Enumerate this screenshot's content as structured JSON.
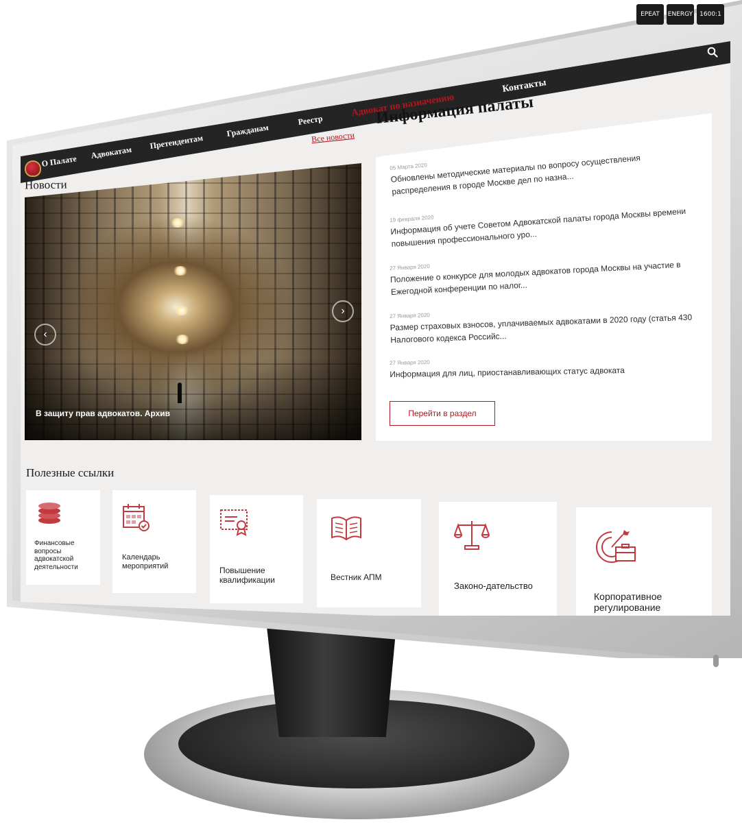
{
  "monitor": {
    "badges": [
      "EPEAT",
      "ENERGY",
      "1600:1"
    ]
  },
  "nav": {
    "items": [
      "О Палате",
      "Адвокатам",
      "Претендентам",
      "Гражданам",
      "Реестр",
      "Адвокат по назначению",
      "Контакты"
    ],
    "search_icon": "search-icon",
    "accent_color": "#b5151e",
    "bar_color": "#242424"
  },
  "news": {
    "title": "Новости",
    "all_news": "Все новости",
    "photo_caption": "В защиту прав адвокатов. Архив"
  },
  "info": {
    "title": "Информация палаты",
    "items": [
      {
        "date": "05 Марта 2020",
        "text": "Обновлены методические материалы по вопросу осуществления распределения в городе Москве дел по назна..."
      },
      {
        "date": "19 февраля 2020",
        "text": "Информация об учете Советом Адвокатской палаты города Москвы времени повышения профессионального уро..."
      },
      {
        "date": "27 Января 2020",
        "text": "Положение о конкурсе для молодых адвокатов города Москвы на участие в Ежегодной конференции по налог..."
      },
      {
        "date": "27 Января 2020",
        "text": "Размер страховых взносов, уплачиваемых адвокатами в 2020 году (статья 430 Налогового кодекса Российс..."
      },
      {
        "date": "27 Января 2020",
        "text": "Информация для лиц, приостанавливающих статус адвоката"
      }
    ],
    "button": "Перейти в раздел"
  },
  "links": {
    "title": "Полезные ссылки",
    "items": [
      {
        "label": "Финансовые вопросы адвокатской деятельности",
        "icon": "coins-icon"
      },
      {
        "label": "Календарь мероприятий",
        "icon": "calendar-icon"
      },
      {
        "label": "Повышение квалификации",
        "icon": "certificate-icon"
      },
      {
        "label": "Вестник АПМ",
        "icon": "book-icon"
      },
      {
        "label": "Законо-дательство",
        "icon": "scales-icon"
      },
      {
        "label": "Корпоративное регулирование",
        "icon": "target-briefcase-icon"
      }
    ]
  }
}
